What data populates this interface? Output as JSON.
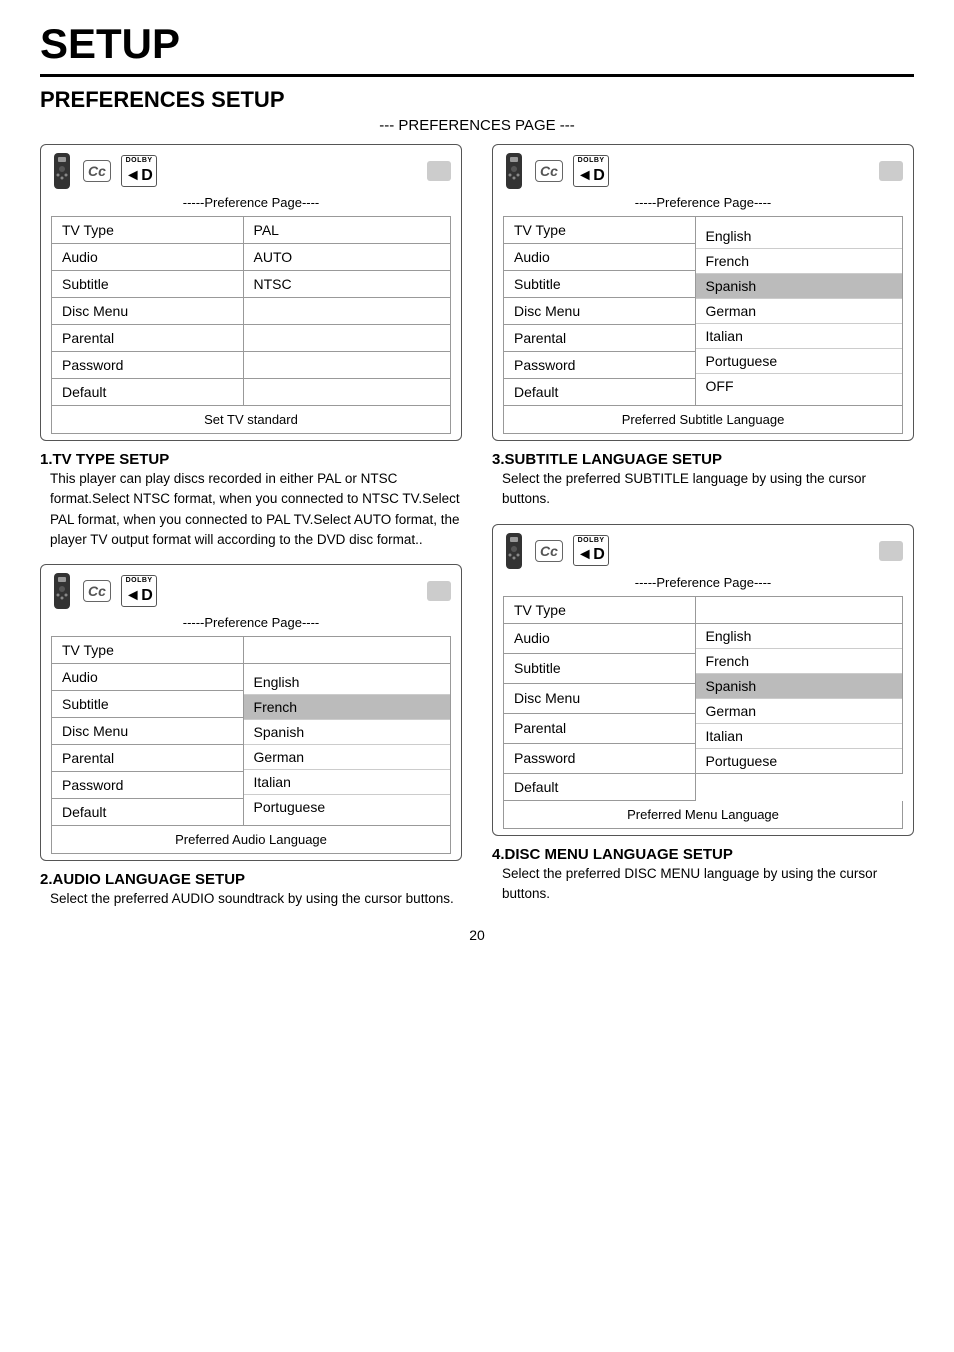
{
  "title": "SETUP",
  "section_main": "PREFERENCES SETUP",
  "page_label": "--- PREFERENCES PAGE ---",
  "pref_page_label": "-----Preference Page----",
  "device": {
    "cc_label": "Cc",
    "dolby_label": "DOLBY",
    "dolby_dd": "◄D"
  },
  "panels": {
    "panel1": {
      "rows": [
        {
          "label": "TV Type",
          "value": "PAL"
        },
        {
          "label": "Audio",
          "value": "AUTO"
        },
        {
          "label": "Subtitle",
          "value": "NTSC"
        },
        {
          "label": "Disc Menu",
          "value": ""
        },
        {
          "label": "Parental",
          "value": ""
        },
        {
          "label": "Password",
          "value": ""
        },
        {
          "label": "Default",
          "value": ""
        }
      ],
      "footer": "Set TV standard"
    },
    "panel2": {
      "rows": [
        {
          "label": "TV Type",
          "value": ""
        },
        {
          "label": "Audio",
          "value": ""
        },
        {
          "label": "Subtitle",
          "value": ""
        },
        {
          "label": "Disc Menu",
          "value": ""
        },
        {
          "label": "Parental",
          "value": ""
        },
        {
          "label": "Password",
          "value": ""
        },
        {
          "label": "Default",
          "value": ""
        }
      ],
      "dropdown": [
        "English",
        "French",
        "Spanish",
        "German",
        "Italian",
        "Portuguese",
        "OFF"
      ],
      "selected": "Spanish",
      "footer": "Preferred Subtitle Language"
    },
    "panel3": {
      "rows": [
        {
          "label": "TV Type",
          "value": ""
        },
        {
          "label": "Audio",
          "value": ""
        },
        {
          "label": "Subtitle",
          "value": ""
        },
        {
          "label": "Disc Menu",
          "value": ""
        },
        {
          "label": "Parental",
          "value": ""
        },
        {
          "label": "Password",
          "value": ""
        },
        {
          "label": "Default",
          "value": ""
        }
      ],
      "dropdown": [
        "English",
        "French",
        "Spanish",
        "German",
        "Italian",
        "Portuguese"
      ],
      "selected": "French",
      "footer": "Preferred Audio Language"
    },
    "panel4": {
      "rows": [
        {
          "label": "TV Type",
          "value": ""
        },
        {
          "label": "Audio",
          "value": ""
        },
        {
          "label": "Subtitle",
          "value": ""
        },
        {
          "label": "Disc Menu",
          "value": ""
        },
        {
          "label": "Parental",
          "value": ""
        },
        {
          "label": "Password",
          "value": ""
        },
        {
          "label": "Default",
          "value": ""
        }
      ],
      "dropdown": [
        "English",
        "French",
        "Spanish",
        "German",
        "Italian",
        "Portuguese"
      ],
      "selected": "Spanish",
      "footer": "Preferred Menu Language"
    }
  },
  "sections": {
    "s1": {
      "num": "1.",
      "title": "TV TYPE SETUP",
      "body": "This player can play discs recorded in either PAL or NTSC format.Select NTSC format, when you connected to NTSC TV.Select PAL format, when you connected to PAL TV.Select AUTO format, the player TV output format will according to the DVD disc format.."
    },
    "s2": {
      "num": "2.",
      "title": "AUDIO LANGUAGE SETUP",
      "body": "Select the preferred AUDIO soundtrack by using the cursor buttons."
    },
    "s3": {
      "num": "3.",
      "title": "SUBTITLE LANGUAGE SETUP",
      "body": "Select the preferred SUBTITLE language by using the cursor buttons."
    },
    "s4": {
      "num": "4.",
      "title": "DISC MENU LANGUAGE SETUP",
      "body": "Select the preferred DISC MENU language by using the cursor buttons."
    }
  },
  "page_number": "20"
}
